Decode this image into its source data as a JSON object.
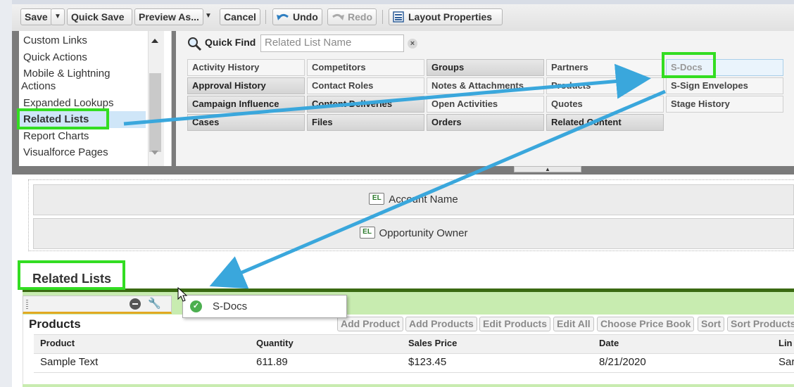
{
  "toolbar": {
    "save": "Save",
    "save_menu": "▼",
    "quick_save": "Quick Save",
    "preview_as": "Preview As...",
    "preview_menu": "▼",
    "cancel": "Cancel",
    "undo": "Undo",
    "redo": "Redo",
    "layout_properties": "Layout Properties"
  },
  "sidebar": {
    "items": [
      "Custom Links",
      "Quick Actions",
      "Mobile & Lightning",
      "Actions",
      "Expanded Lookups",
      "Related Lists",
      "Report Charts",
      "Visualforce Pages"
    ],
    "selected": "Related Lists"
  },
  "quick_find": {
    "label": "Quick Find",
    "placeholder": "Related List Name",
    "clear": "×"
  },
  "palette": {
    "row1": [
      "Activity History",
      "Competitors",
      "Groups",
      "Partners",
      "S-Docs"
    ],
    "row2": [
      "Approval History",
      "Contact Roles",
      "Notes & Attachments",
      "Products",
      "S-Sign Envelopes"
    ],
    "row3": [
      "Campaign Influence",
      "Content Deliveries",
      "Open Activities",
      "Quotes",
      "Stage History"
    ],
    "row4": [
      "Cases",
      "Files",
      "Orders",
      "Related Content"
    ],
    "handle": "▲"
  },
  "fields": {
    "badge": "EL",
    "account_name": "Account Name",
    "opportunity_owner": "Opportunity Owner"
  },
  "related_lists": {
    "title": "Related Lists",
    "dragging_item": "S-Docs",
    "check": "✓",
    "products_title": "Products",
    "buttons": [
      "Add Product",
      "Add Products",
      "Edit Products",
      "Edit All",
      "Choose Price Book",
      "Sort",
      "Sort Products"
    ],
    "columns": [
      "Product",
      "Quantity",
      "Sales Price",
      "Date",
      "Lin"
    ],
    "row": [
      "Sample Text",
      "611.89",
      "$123.45",
      "8/21/2020",
      "Sar"
    ]
  },
  "colors": {
    "highlight": "#33dd22",
    "arrow": "#3aa7dc",
    "section_bar": "#3a6a12",
    "section_band": "#c8ecb0"
  }
}
